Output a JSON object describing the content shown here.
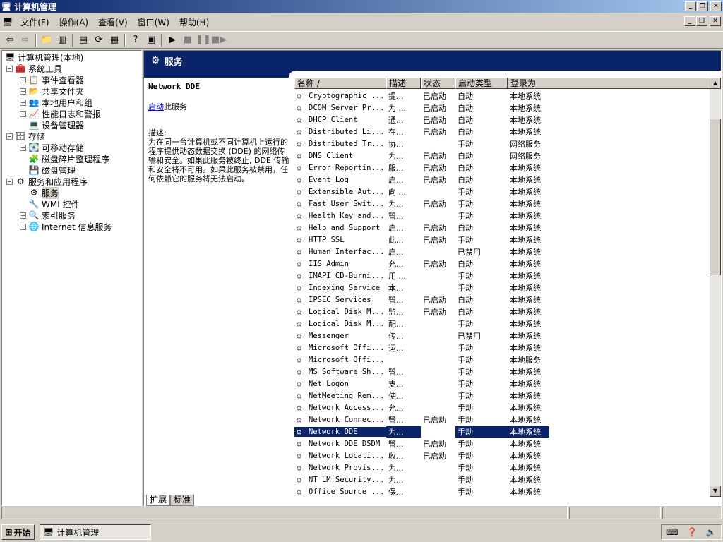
{
  "window": {
    "title": "计算机管理"
  },
  "menu": [
    {
      "name": "file",
      "label": "文件(F)"
    },
    {
      "name": "action",
      "label": "操作(A)"
    },
    {
      "name": "view",
      "label": "查看(V)"
    },
    {
      "name": "window",
      "label": "窗口(W)"
    },
    {
      "name": "help",
      "label": "帮助(H)"
    }
  ],
  "tree": {
    "root": "计算机管理(本地)",
    "system_tools": "系统工具",
    "event_viewer": "事件查看器",
    "shared_folders": "共享文件夹",
    "local_users": "本地用户和组",
    "perf_logs": "性能日志和警报",
    "device_manager": "设备管理器",
    "storage": "存储",
    "removable_storage": "可移动存储",
    "disk_defrag": "磁盘碎片整理程序",
    "disk_management": "磁盘管理",
    "services_apps": "服务和应用程序",
    "services": "服务",
    "wmi_control": "WMI 控件",
    "indexing_service": "索引服务",
    "iis": "Internet 信息服务"
  },
  "panel": {
    "header": "服务"
  },
  "description": {
    "service_name": "Network DDE",
    "start_link": "启动",
    "start_suffix": "此服务",
    "label": "描述:",
    "text": "为在同一台计算机或不同计算机上运行的程序提供动态数据交换 (DDE) 的网络传输和安全。如果此服务被终止, DDE 传输和安全将不可用。如果此服务被禁用，任何依赖它的服务将无法启动。"
  },
  "columns": [
    "名称 /",
    "描述",
    "状态",
    "启动类型",
    "登录为"
  ],
  "services": [
    {
      "name": "Cryptographic ...",
      "desc": "提...",
      "status": "已启动",
      "startup": "自动",
      "logon": "本地系统"
    },
    {
      "name": "DCOM Server Pr...",
      "desc": "为 ...",
      "status": "已启动",
      "startup": "自动",
      "logon": "本地系统"
    },
    {
      "name": "DHCP Client",
      "desc": "通...",
      "status": "已启动",
      "startup": "自动",
      "logon": "本地系统"
    },
    {
      "name": "Distributed Li...",
      "desc": "在...",
      "status": "已启动",
      "startup": "自动",
      "logon": "本地系统"
    },
    {
      "name": "Distributed Tr...",
      "desc": "协...",
      "status": "",
      "startup": "手动",
      "logon": "网络服务"
    },
    {
      "name": "DNS Client",
      "desc": "为...",
      "status": "已启动",
      "startup": "自动",
      "logon": "网络服务"
    },
    {
      "name": "Error Reportin...",
      "desc": "服...",
      "status": "已启动",
      "startup": "自动",
      "logon": "本地系统"
    },
    {
      "name": "Event Log",
      "desc": "启...",
      "status": "已启动",
      "startup": "自动",
      "logon": "本地系统"
    },
    {
      "name": "Extensible Aut...",
      "desc": "向 ...",
      "status": "",
      "startup": "手动",
      "logon": "本地系统"
    },
    {
      "name": "Fast User Swit...",
      "desc": "为...",
      "status": "已启动",
      "startup": "手动",
      "logon": "本地系统"
    },
    {
      "name": "Health Key and...",
      "desc": "管...",
      "status": "",
      "startup": "手动",
      "logon": "本地系统"
    },
    {
      "name": "Help and Support",
      "desc": "启...",
      "status": "已启动",
      "startup": "自动",
      "logon": "本地系统"
    },
    {
      "name": "HTTP SSL",
      "desc": "此...",
      "status": "已启动",
      "startup": "手动",
      "logon": "本地系统"
    },
    {
      "name": "Human Interfac...",
      "desc": "启...",
      "status": "",
      "startup": "已禁用",
      "logon": "本地系统"
    },
    {
      "name": "IIS Admin",
      "desc": "允...",
      "status": "已启动",
      "startup": "自动",
      "logon": "本地系统"
    },
    {
      "name": "IMAPI CD-Burni...",
      "desc": "用 ...",
      "status": "",
      "startup": "手动",
      "logon": "本地系统"
    },
    {
      "name": "Indexing Service",
      "desc": "本...",
      "status": "",
      "startup": "手动",
      "logon": "本地系统"
    },
    {
      "name": "IPSEC Services",
      "desc": "管...",
      "status": "已启动",
      "startup": "自动",
      "logon": "本地系统"
    },
    {
      "name": "Logical Disk M...",
      "desc": "监...",
      "status": "已启动",
      "startup": "自动",
      "logon": "本地系统"
    },
    {
      "name": "Logical Disk M...",
      "desc": "配...",
      "status": "",
      "startup": "手动",
      "logon": "本地系统"
    },
    {
      "name": "Messenger",
      "desc": "传...",
      "status": "",
      "startup": "已禁用",
      "logon": "本地系统"
    },
    {
      "name": "Microsoft Offi...",
      "desc": "运...",
      "status": "",
      "startup": "手动",
      "logon": "本地系统"
    },
    {
      "name": "Microsoft Offi...",
      "desc": "",
      "status": "",
      "startup": "手动",
      "logon": "本地服务"
    },
    {
      "name": "MS Software Sh...",
      "desc": "管...",
      "status": "",
      "startup": "手动",
      "logon": "本地系统"
    },
    {
      "name": "Net Logon",
      "desc": "支...",
      "status": "",
      "startup": "手动",
      "logon": "本地系统"
    },
    {
      "name": "NetMeeting Rem...",
      "desc": "使...",
      "status": "",
      "startup": "手动",
      "logon": "本地系统"
    },
    {
      "name": "Network Access...",
      "desc": "允...",
      "status": "",
      "startup": "手动",
      "logon": "本地系统"
    },
    {
      "name": "Network Connec...",
      "desc": "管...",
      "status": "已启动",
      "startup": "手动",
      "logon": "本地系统"
    },
    {
      "name": "Network DDE",
      "desc": "为...",
      "status": "",
      "startup": "手动",
      "logon": "本地系统"
    },
    {
      "name": "Network DDE DSDM",
      "desc": "管...",
      "status": "已启动",
      "startup": "手动",
      "logon": "本地系统"
    },
    {
      "name": "Network Locati...",
      "desc": "收...",
      "status": "已启动",
      "startup": "手动",
      "logon": "本地系统"
    },
    {
      "name": "Network Provis...",
      "desc": "为...",
      "status": "",
      "startup": "手动",
      "logon": "本地系统"
    },
    {
      "name": "NT LM Security...",
      "desc": "为...",
      "status": "",
      "startup": "手动",
      "logon": "本地系统"
    },
    {
      "name": "Office Source ...",
      "desc": "保...",
      "status": "",
      "startup": "手动",
      "logon": "本地系统"
    }
  ],
  "selected_service": "Network DDE",
  "tabs": {
    "extended": "扩展",
    "standard": "标准"
  },
  "taskbar": {
    "start": "开始",
    "task": "计算机管理"
  },
  "colors": {
    "titlebar": "#0a246a",
    "selection": "#0a246a",
    "chrome": "#d4d0c8"
  }
}
